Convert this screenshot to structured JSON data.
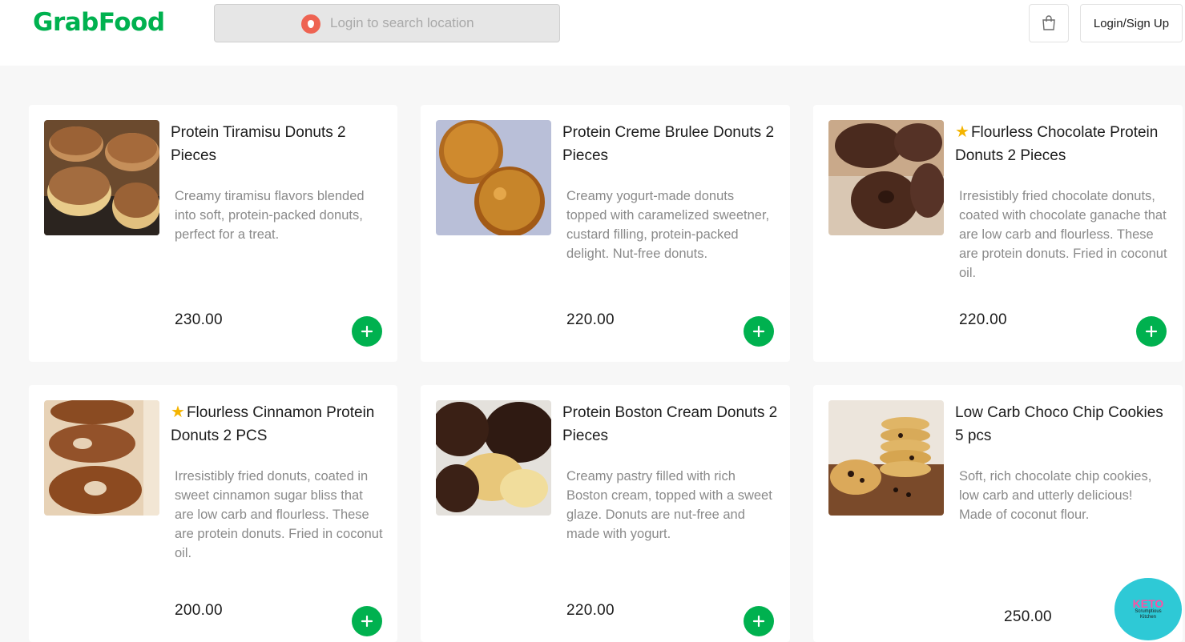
{
  "header": {
    "logo": "GrabFood",
    "search_placeholder": "Login to search location",
    "login_label": "Login/Sign Up"
  },
  "colors": {
    "brand_green": "#00b14f",
    "pin_red": "#ee6352",
    "star_yellow": "#f4b400"
  },
  "products": [
    {
      "name": "Protein Tiramisu Donuts 2 Pieces",
      "star": false,
      "description": "Creamy tiramisu flavors blended into soft, protein-packed donuts, perfect for a treat.",
      "price": "230.00"
    },
    {
      "name": "Protein Creme Brulee Donuts 2 Pieces",
      "star": false,
      "description": "Creamy yogurt-made donuts topped with caramelized sweetner, custard filling, protein-packed delight. Nut-free donuts.",
      "price": "220.00"
    },
    {
      "name": "Flourless Chocolate Protein Donuts 2 Pieces",
      "star": true,
      "description": "Irresistibly fried chocolate donuts, coated with chocolate ganache that are low carb and flourless. These are protein donuts. Fried in coconut oil.",
      "price": "220.00"
    },
    {
      "name": "Flourless Cinnamon Protein Donuts 2 PCS",
      "star": true,
      "description": "Irresistibly fried donuts, coated in sweet cinnamon sugar bliss that are low carb and flourless. These are protein donuts. Fried in coconut oil.",
      "price": "200.00"
    },
    {
      "name": "Protein Boston Cream Donuts 2 Pieces",
      "star": false,
      "description": "Creamy pastry filled with rich Boston cream, topped with a sweet glaze. Donuts are nut-free and made with yogurt.",
      "price": "220.00"
    },
    {
      "name": "Low Carb Choco Chip Cookies 5 pcs",
      "star": false,
      "description": "Soft, rich chocolate chip cookies, low carb and utterly delicious! Made of coconut flour.",
      "price": "250.00"
    }
  ],
  "badge": {
    "title": "KETO",
    "subtitle": "Scrumptious Kitchen"
  }
}
